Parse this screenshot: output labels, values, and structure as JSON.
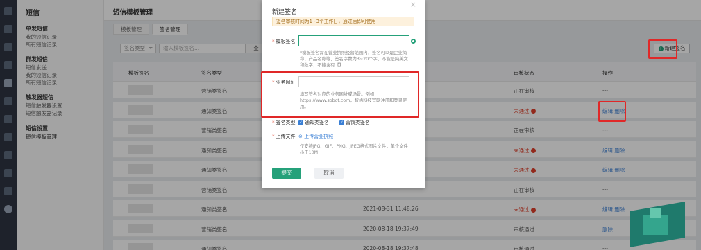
{
  "leftnav": {
    "title": "短信",
    "groups": [
      {
        "label": "单发短信",
        "items": [
          "我的短信记录",
          "所有短信记录"
        ]
      },
      {
        "label": "群发短信",
        "items": [
          "短信发送",
          "我的短信记录",
          "所有短信记录"
        ]
      },
      {
        "label": "触发器短信",
        "items": [
          "短信触发器设置",
          "短信触发器记录"
        ]
      },
      {
        "label": "短信设置",
        "items": [
          "短信模板管理"
        ]
      }
    ]
  },
  "main": {
    "title": "短信模板管理",
    "tabs": [
      "模板管理",
      "签名管理"
    ],
    "filter": {
      "type_label": "签名类型",
      "search_placeholder": "输入模板签名...",
      "query_label": "查"
    },
    "new_button": "新建签名",
    "columns": [
      "模板签名",
      "签名类型",
      "审核状态",
      "操作"
    ],
    "rows": [
      {
        "type": "营销类签名",
        "time": "",
        "status": "正在审核",
        "status_kind": "pending",
        "ops": "---"
      },
      {
        "type": "通知类签名",
        "time": "",
        "status": "未通过",
        "status_kind": "fail",
        "ops": "编辑 删除"
      },
      {
        "type": "营销类签名",
        "time": "",
        "status": "正在审核",
        "status_kind": "pending",
        "ops": "---"
      },
      {
        "type": "通知类签名",
        "time": "",
        "status": "未通过",
        "status_kind": "fail",
        "ops": "编辑 删除"
      },
      {
        "type": "通知类签名",
        "time": "",
        "status": "未通过",
        "status_kind": "fail",
        "ops": "编辑 删除"
      },
      {
        "type": "营销类签名",
        "time": "",
        "status": "正在审核",
        "status_kind": "pending",
        "ops": "---"
      },
      {
        "type": "通知类签名",
        "time": "2021-08-31 11:48:26",
        "status": "未通过",
        "status_kind": "fail",
        "ops": "编辑 删除"
      },
      {
        "type": "营销类签名",
        "time": "2020-08-18 19:37:49",
        "status": "审核通过",
        "status_kind": "ok",
        "ops": "删除"
      },
      {
        "type": "通知类签名",
        "time": "2020-08-18 19:37:48",
        "status": "审核通过",
        "status_kind": "ok",
        "ops": "---"
      }
    ]
  },
  "modal": {
    "title": "新建签名",
    "close": "×",
    "notice": "签名审核时间为1~3个工作日，通过后即可使用",
    "sign_label": "模板签名",
    "sign_hint": "*模板签名需在营业执照经营范围内，签名可以是企业简称、产品名称等，签名字数为3~20个字，不能是纯英文和数字，不能含有【】",
    "url_label": "业务网址",
    "url_hint": "填写签名对应的业务网址或场景。例如：https://www.sobot.com，智齿科技官网注册和登录使用。",
    "type_label": "签名类型",
    "type_options": [
      "通知类签名",
      "营销类签名"
    ],
    "upload_label": "上传文件",
    "upload_link": "上传营业执照",
    "upload_hint": "仅支持JPG、GIF、PNG、JPEG格式图片文件，单个文件小于10M",
    "submit": "提交",
    "cancel": "取消"
  },
  "colors": {
    "accent": "#25a17a",
    "link": "#3a7fd5",
    "danger": "#e0402b",
    "annotation": "#e02828"
  }
}
